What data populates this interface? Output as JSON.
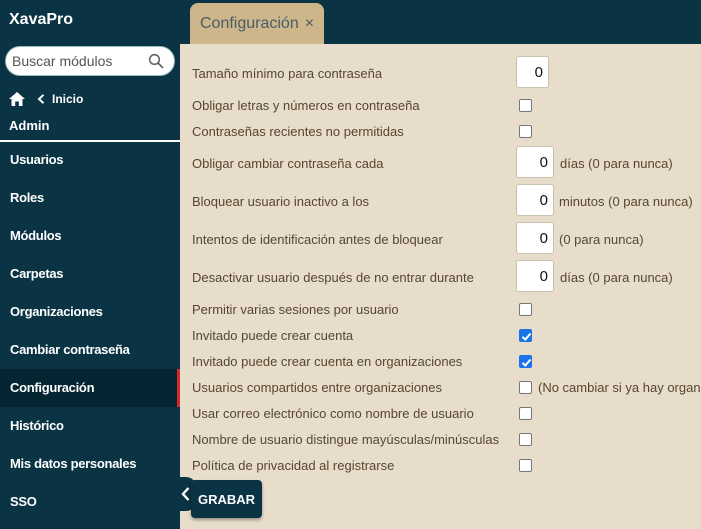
{
  "app": {
    "brand": "XavaPro"
  },
  "search": {
    "placeholder": "Buscar módulos"
  },
  "breadcrumb": {
    "back_label": "Inicio"
  },
  "sidebar": {
    "section_title": "Admin",
    "items": [
      {
        "label": "Usuarios"
      },
      {
        "label": "Roles"
      },
      {
        "label": "Módulos"
      },
      {
        "label": "Carpetas"
      },
      {
        "label": "Organizaciones"
      },
      {
        "label": "Cambiar contraseña"
      },
      {
        "label": "Configuración",
        "active": true
      },
      {
        "label": "Histórico"
      },
      {
        "label": "Mis datos personales"
      },
      {
        "label": "SSO"
      }
    ]
  },
  "tab": {
    "label": "Configuración",
    "close_glyph": "×"
  },
  "form": {
    "min_password_length": {
      "label": "Tamaño mínimo para contraseña",
      "value": "0"
    },
    "require_letters_numbers": {
      "label": "Obligar letras y números en contraseña",
      "checked": false
    },
    "recent_passwords": {
      "label": "Contraseñas recientes no permitidas",
      "checked": false
    },
    "force_change_days": {
      "label": "Obligar cambiar contraseña cada",
      "value": "0",
      "suffix": "días (0 para nunca)"
    },
    "lock_inactive_minutes": {
      "label": "Bloquear usuario inactivo a los",
      "value": "0",
      "suffix": "minutos (0 para nunca)"
    },
    "login_attempts": {
      "label": "Intentos de identificación antes de bloquear",
      "value": "0",
      "suffix": "(0 para nunca)"
    },
    "deactivate_days": {
      "label": "Desactivar usuario después de no entrar durante",
      "value": "0",
      "suffix": "días (0 para nunca)"
    },
    "multiple_sessions": {
      "label": "Permitir varias sesiones por usuario",
      "checked": false
    },
    "guest_create_account": {
      "label": "Invitado puede crear cuenta",
      "checked": true
    },
    "guest_create_account_orgs": {
      "label": "Invitado puede crear cuenta en organizaciones",
      "checked": true
    },
    "shared_users_orgs": {
      "label": "Usuarios compartidos entre organizaciones",
      "checked": false,
      "note": "(No cambiar si ya hay organ"
    },
    "email_as_username": {
      "label": "Usar correo electrónico como nombre de usuario",
      "checked": false
    },
    "case_sensitive_username": {
      "label": "Nombre de usuario distingue mayúsculas/minúsculas",
      "checked": false
    },
    "privacy_policy": {
      "label": "Política de privacidad al registrarse",
      "checked": false
    }
  },
  "actions": {
    "save_label": "GRABAR"
  },
  "colors": {
    "sidebar_bg": "#0a3344",
    "content_bg": "#e8ddcb",
    "tab_bg": "#ccb68a",
    "active_marker": "#d42a2a",
    "checkbox_checked": "#1a73e8"
  }
}
